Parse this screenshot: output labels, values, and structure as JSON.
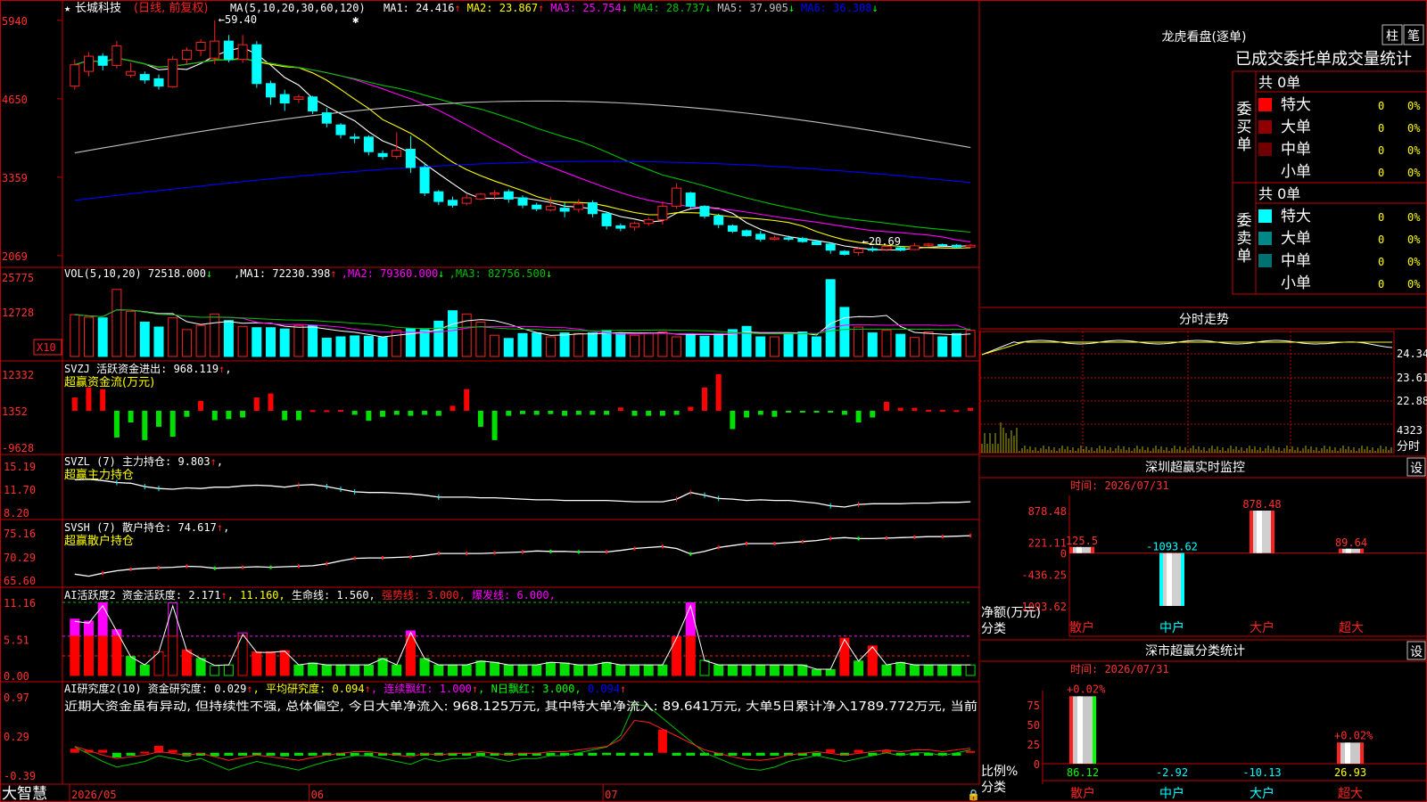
{
  "app": {
    "brand": "大智慧",
    "stock_name": "长城科技",
    "stock_mode": "(日线, 前复权)"
  },
  "colors": {
    "up": "#ff2020",
    "down": "#00ffff",
    "ma1": "#ffffff",
    "ma2": "#ffff00",
    "ma3": "#ff00ff",
    "ma4": "#00c000",
    "ma5": "#c0c0c0",
    "ma6": "#0000ff",
    "frame": "#c00000"
  },
  "dates": {
    "labels": [
      "2026/05",
      "06",
      "07"
    ],
    "label_index": [
      0,
      17,
      38
    ]
  },
  "main": {
    "title": "MA(5,10,20,30,60,120)",
    "ma_values": [
      {
        "label": "MA1: 24.416",
        "arrow": "↑",
        "color": "#ffffff"
      },
      {
        "label": "MA2: 23.867",
        "arrow": "↑",
        "color": "#ffff00"
      },
      {
        "label": "MA3: 25.754",
        "arrow": "↓",
        "color": "#ff00ff"
      },
      {
        "label": "MA4: 28.737",
        "arrow": "↓",
        "color": "#00c000"
      },
      {
        "label": "MA5: 37.905",
        "arrow": "↓",
        "color": "#c0c0c0"
      },
      {
        "label": "MA6: 36.308",
        "arrow": "↓",
        "color": "#0000ff"
      }
    ],
    "y_ticks": [
      "5940",
      "4650",
      "3359",
      "2069"
    ],
    "high_label": "59.40",
    "low_label": "←20.69",
    "candles": [
      [
        48.6,
        52.1,
        48.0,
        53.0
      ],
      [
        51.0,
        53.5,
        50.2,
        54.2
      ],
      [
        53.5,
        52.0,
        51.2,
        54.0
      ],
      [
        52.0,
        55.2,
        51.5,
        56.0
      ],
      [
        50.4,
        51.0,
        50.0,
        52.4
      ],
      [
        50.5,
        49.6,
        49.0,
        51.0
      ],
      [
        49.8,
        48.6,
        48.0,
        50.5
      ],
      [
        48.5,
        53.0,
        48.3,
        53.5
      ],
      [
        53.0,
        54.5,
        52.2,
        55.0
      ],
      [
        54.5,
        55.8,
        53.5,
        56.3
      ],
      [
        53.2,
        56.0,
        52.2,
        59.4
      ],
      [
        56.0,
        53.0,
        52.5,
        57.0
      ],
      [
        53.0,
        55.4,
        52.4,
        57.0
      ],
      [
        55.4,
        49.0,
        48.3,
        56.0
      ],
      [
        49.0,
        46.8,
        45.5,
        49.5
      ],
      [
        47.2,
        45.8,
        44.5,
        48.0
      ],
      [
        46.4,
        46.8,
        45.8,
        47.2
      ],
      [
        46.8,
        44.5,
        44.0,
        47.0
      ],
      [
        44.2,
        42.5,
        41.8,
        45.0
      ],
      [
        42.2,
        40.6,
        40.0,
        42.5
      ],
      [
        40.2,
        40.0,
        39.2,
        40.8
      ],
      [
        40.2,
        37.8,
        37.2,
        40.5
      ],
      [
        37.5,
        37.0,
        36.5,
        38.0
      ],
      [
        37.0,
        38.0,
        36.6,
        41.0
      ],
      [
        38.2,
        35.2,
        34.3,
        40.4
      ],
      [
        35.2,
        31.0,
        30.5,
        36.0
      ],
      [
        31.2,
        29.6,
        29.0,
        31.5
      ],
      [
        29.8,
        29.0,
        28.6,
        30.4
      ],
      [
        29.3,
        30.2,
        29.0,
        30.8
      ],
      [
        30.0,
        30.8,
        29.8,
        31.0
      ],
      [
        30.8,
        31.0,
        29.8,
        31.5
      ],
      [
        31.2,
        30.0,
        29.4,
        31.6
      ],
      [
        30.2,
        29.0,
        28.5,
        30.6
      ],
      [
        29.0,
        28.4,
        28.0,
        29.4
      ],
      [
        28.2,
        28.8,
        28.0,
        30.4
      ],
      [
        28.5,
        28.0,
        27.0,
        29.4
      ],
      [
        28.3,
        29.2,
        27.8,
        30.0
      ],
      [
        29.4,
        27.6,
        27.0,
        29.8
      ],
      [
        27.6,
        25.6,
        25.0,
        28.0
      ],
      [
        25.6,
        25.2,
        24.7,
        26.0
      ],
      [
        25.4,
        26.0,
        24.8,
        26.3
      ],
      [
        26.0,
        26.6,
        25.6,
        27.0
      ],
      [
        26.6,
        28.8,
        25.8,
        29.6
      ],
      [
        28.8,
        31.8,
        28.4,
        32.6
      ],
      [
        31.0,
        28.8,
        28.5,
        31.2
      ],
      [
        28.8,
        27.2,
        26.8,
        29.0
      ],
      [
        27.2,
        25.8,
        25.2,
        27.6
      ],
      [
        25.6,
        24.7,
        24.4,
        25.8
      ],
      [
        24.8,
        24.0,
        23.8,
        25.0
      ],
      [
        24.2,
        23.4,
        23.0,
        24.8
      ],
      [
        23.4,
        23.6,
        23.2,
        24.0
      ],
      [
        23.6,
        23.4,
        23.1,
        24.0
      ],
      [
        23.5,
        23.0,
        22.8,
        23.8
      ],
      [
        23.0,
        22.5,
        22.4,
        23.2
      ],
      [
        22.6,
        21.6,
        21.0,
        22.8
      ],
      [
        21.4,
        20.9,
        20.7,
        21.6
      ],
      [
        21.2,
        21.8,
        20.69,
        22.0
      ],
      [
        21.8,
        21.6,
        21.3,
        22.2
      ],
      [
        21.7,
        22.2,
        21.4,
        22.4
      ],
      [
        22.0,
        21.6,
        21.4,
        22.3
      ],
      [
        21.7,
        22.3,
        21.6,
        22.8
      ],
      [
        22.4,
        22.6,
        22.1,
        22.8
      ],
      [
        22.5,
        22.4,
        22.2,
        22.7
      ],
      [
        22.4,
        22.1,
        21.9,
        22.6
      ],
      [
        22.1,
        22.4,
        22.0,
        22.6
      ]
    ]
  },
  "vol": {
    "title": "VOL(5,10,20)",
    "current": "72518.000",
    "current_arrow": "↓",
    "mas": [
      {
        "label": "MA1: 72230.398",
        "arrow": "↑",
        "color": "#ffffff"
      },
      {
        "label": "MA2: 79360.000",
        "arrow": "↓",
        "color": "#ff00ff"
      },
      {
        "label": "MA3: 82756.500",
        "arrow": "↓",
        "color": "#00c000"
      }
    ],
    "y_ticks": [
      "25775",
      "12728"
    ],
    "unit": "X10",
    "values": [
      128,
      120,
      118,
      205,
      138,
      105,
      90,
      118,
      82,
      95,
      130,
      110,
      92,
      88,
      88,
      84,
      95,
      95,
      56,
      60,
      63,
      62,
      58,
      80,
      85,
      82,
      108,
      140,
      130,
      105,
      65,
      55,
      70,
      72,
      60,
      72,
      70,
      72,
      80,
      70,
      65,
      72,
      75,
      60,
      68,
      62,
      70,
      82,
      92,
      60,
      60,
      72,
      75,
      60,
      235,
      150,
      90,
      72,
      80,
      68,
      58,
      75,
      60,
      70,
      80
    ]
  },
  "svzj": {
    "title": "SVZJ 活跃资金进出: 968.119",
    "arrow": "↑",
    "subtitle": "超赢资金流(万元)",
    "y_ticks": [
      "12332",
      "1352",
      "-9628"
    ],
    "values": [
      4000,
      7000,
      6500,
      -8000,
      -3500,
      -8800,
      -4800,
      -7800,
      -1800,
      3000,
      -2800,
      -2500,
      -2000,
      4000,
      5200,
      -2800,
      -2800,
      200,
      150,
      250,
      -1200,
      -3000,
      -1800,
      -1200,
      -1500,
      -1200,
      -1500,
      1500,
      6500,
      -4800,
      -8800,
      -1500,
      -1000,
      -1200,
      -1000,
      -1500,
      -1200,
      -1200,
      -1200,
      1000,
      -1500,
      -1500,
      -1500,
      -1200,
      1200,
      7000,
      11000,
      -5500,
      -2000,
      -1200,
      -1800,
      -500,
      -500,
      -500,
      -500,
      -1200,
      -3500,
      -2000,
      2700,
      900,
      900,
      300,
      300,
      200,
      900
    ]
  },
  "svzl": {
    "title": "SVZL (7) 主力持仓: 9.803",
    "arrow": "↑",
    "subtitle": "超赢主力持仓",
    "y_ticks": [
      "15.19",
      "11.70",
      "8.20"
    ],
    "values": [
      13.1,
      13.2,
      13.0,
      12.7,
      12.6,
      12.1,
      11.8,
      11.7,
      11.9,
      11.8,
      12.0,
      12.0,
      12.2,
      12.3,
      12.2,
      12.0,
      12.3,
      12.4,
      12.1,
      11.7,
      11.3,
      11.2,
      11.2,
      11.1,
      11.0,
      10.8,
      10.5,
      10.5,
      10.5,
      10.4,
      10.4,
      10.3,
      10.2,
      10.1,
      10.1,
      10.0,
      10.0,
      10.0,
      10.0,
      9.9,
      9.8,
      9.8,
      9.8,
      10.2,
      11.2,
      10.8,
      10.3,
      10.2,
      10.0,
      10.1,
      10.0,
      10.0,
      9.8,
      9.6,
      9.2,
      9.0,
      9.4,
      9.5,
      9.5,
      9.5,
      9.6,
      9.6,
      9.7,
      9.7,
      9.8
    ]
  },
  "svsh": {
    "title": "SVSH (7) 散户持仓: 74.617",
    "arrow": "↑",
    "subtitle": "超赢散户持仓",
    "y_ticks": [
      "75.16",
      "70.29",
      "65.60"
    ],
    "values": [
      66.8,
      66.4,
      67.0,
      67.5,
      67.8,
      68.0,
      68.1,
      68.2,
      68.4,
      68.3,
      68.0,
      68.1,
      68.2,
      68.3,
      68.2,
      68.3,
      68.4,
      68.5,
      68.9,
      69.5,
      70.0,
      70.1,
      70.1,
      70.2,
      70.3,
      70.6,
      71.0,
      71.0,
      71.0,
      71.0,
      71.1,
      71.2,
      71.3,
      71.5,
      71.4,
      71.4,
      71.3,
      71.3,
      71.3,
      71.6,
      72.0,
      72.2,
      72.4,
      72.0,
      70.9,
      71.4,
      72.2,
      72.6,
      73.0,
      73.0,
      73.0,
      73.2,
      73.4,
      73.6,
      74.0,
      74.2,
      74.0,
      74.0,
      74.1,
      74.2,
      74.3,
      74.4,
      74.4,
      74.5,
      74.6
    ]
  },
  "ai_active": {
    "title": "AI活跃度2 资金活跃度: 2.171",
    "arrow": "↑",
    "parts": [
      {
        "text": ", 11.160,",
        "color": "#ffff00"
      },
      {
        "text": " 生命线: 1.560,",
        "color": "#ffffff"
      },
      {
        "text": " 强势线: 3.000,",
        "color": "#ff2020"
      },
      {
        "text": " 爆发线: 6.000,",
        "color": "#ff00ff"
      }
    ],
    "y_ticks": [
      "11.16",
      "5.51",
      "0.00"
    ],
    "values": [
      8.6,
      8.3,
      11.1,
      7.0,
      2.9,
      1.6,
      3.6,
      11.1,
      3.9,
      2.6,
      1.5,
      1.6,
      6.5,
      3.6,
      3.6,
      3.8,
      1.6,
      1.9,
      1.6,
      1.6,
      1.6,
      1.6,
      2.6,
      1.6,
      6.8,
      2.6,
      1.6,
      1.6,
      1.6,
      2.2,
      2.0,
      1.6,
      1.6,
      1.6,
      2.0,
      1.9,
      1.6,
      1.6,
      2.0,
      1.6,
      1.6,
      1.6,
      1.6,
      5.9,
      11.1,
      2.3,
      1.6,
      1.6,
      1.6,
      1.6,
      1.6,
      1.6,
      1.6,
      0.9,
      0.9,
      5.7,
      2.2,
      4.5,
      1.6,
      2.0,
      1.6,
      1.6,
      1.6,
      1.6,
      1.6
    ],
    "hollow": [
      false,
      false,
      false,
      false,
      false,
      false,
      true,
      true,
      false,
      false,
      true,
      true,
      true,
      false,
      false,
      false,
      false,
      false,
      false,
      false,
      false,
      false,
      false,
      false,
      false,
      false,
      false,
      false,
      false,
      false,
      false,
      false,
      false,
      false,
      false,
      false,
      false,
      false,
      false,
      false,
      false,
      false,
      false,
      false,
      false,
      true,
      false,
      false,
      false,
      false,
      false,
      false,
      false,
      false,
      false,
      false,
      false,
      false,
      false,
      false,
      false,
      false,
      false,
      false,
      true
    ]
  },
  "ai_research": {
    "title": "AI研究度2(10) 资金研究度: 0.029",
    "arrow": "↑",
    "parts": [
      {
        "text": ", 平均研究度: 0.094",
        "color": "#ffff00",
        "arrow": "↑"
      },
      {
        "text": ", 连续飘红: 1.000",
        "color": "#ff00ff",
        "arrow": "↑"
      },
      {
        "text": ", N日飘红: 3.000,",
        "color": "#00ff00"
      },
      {
        "text": " 0.094",
        "color": "#0000ff",
        "arrow": "↑"
      }
    ],
    "summary": "近期大资金虽有异动, 但持续性不强, 总体偏空, 今日大单净流入: 968.125万元, 其中特大单净流入: 89.641万元, 大单5日累计净入1789.772万元, 当前",
    "y_ticks": [
      "0.97",
      "0.29",
      "-0.39"
    ],
    "values": [
      0.07,
      0.05,
      0.05,
      -0.08,
      -0.05,
      0.02,
      0.12,
      0.05,
      -0.06,
      -0.05,
      -0.06,
      -0.05,
      -0.05,
      -0.04,
      -0.05,
      -0.06,
      -0.05,
      -0.05,
      -0.05,
      -0.05,
      -0.05,
      -0.06,
      -0.05,
      -0.05,
      -0.05,
      -0.05,
      -0.05,
      -0.05,
      -0.05,
      -0.05,
      -0.05,
      -0.05,
      -0.05,
      -0.05,
      -0.05,
      -0.05,
      -0.05,
      -0.05,
      -0.04,
      -0.05,
      -0.05,
      -0.05,
      0.4,
      -0.05,
      -0.05,
      -0.05,
      -0.05,
      -0.05,
      -0.05,
      -0.05,
      -0.05,
      -0.05,
      -0.05,
      -0.05,
      0.06,
      -0.05,
      0.05,
      -0.05,
      0.04,
      -0.05,
      -0.05,
      -0.05,
      -0.05,
      -0.05,
      0.03
    ],
    "line": [
      0.1,
      -0.02,
      -0.15,
      -0.25,
      -0.2,
      -0.15,
      -0.05,
      -0.1,
      -0.15,
      -0.1,
      -0.2,
      -0.3,
      -0.22,
      -0.15,
      -0.2,
      -0.25,
      -0.3,
      -0.22,
      -0.15,
      -0.1,
      -0.05,
      -0.05,
      -0.1,
      -0.15,
      -0.2,
      -0.1,
      -0.15,
      -0.1,
      -0.1,
      -0.05,
      -0.1,
      -0.15,
      -0.1,
      -0.1,
      -0.05,
      -0.05,
      0.0,
      0.05,
      0.1,
      0.3,
      0.85,
      0.8,
      0.6,
      0.4,
      0.2,
      0.0,
      -0.1,
      -0.2,
      -0.28,
      -0.3,
      -0.25,
      -0.15,
      -0.1,
      -0.05,
      -0.1,
      -0.15,
      -0.1,
      -0.05,
      0.0,
      -0.05,
      0.0,
      0.0,
      -0.05,
      0.0,
      0.05
    ]
  },
  "right": {
    "board_title": "龙虎看盘(逐单)",
    "btn_bar": "柱",
    "btn_stroke": "笔",
    "stats_title": "已成交委托单成交量统计",
    "buy_label": "委买单",
    "sell_label": "委卖单",
    "buy_total": "共 0单",
    "sell_total": "共 0单",
    "buy_rows": [
      {
        "name": "特大",
        "count": "0",
        "pct": "0%",
        "color": "#ff0000"
      },
      {
        "name": "大单",
        "count": "0",
        "pct": "0%",
        "color": "#900000"
      },
      {
        "name": "中单",
        "count": "0",
        "pct": "0%",
        "color": "#700000"
      },
      {
        "name": "小单",
        "count": "0",
        "pct": "0%",
        "color": ""
      }
    ],
    "sell_rows": [
      {
        "name": "特大",
        "count": "0",
        "pct": "0%",
        "color": "#00ffff"
      },
      {
        "name": "大单",
        "count": "0",
        "pct": "0%",
        "color": "#008888"
      },
      {
        "name": "中单",
        "count": "0",
        "pct": "0%",
        "color": "#007070"
      },
      {
        "name": "小单",
        "count": "0",
        "pct": "0%",
        "color": ""
      }
    ],
    "intraday_title": "分时走势",
    "intraday_ticks": [
      "24.34",
      "23.61",
      "22.88"
    ],
    "intraday_vol": "4323",
    "intraday_bottom": "分时",
    "monitor_title": "深圳超赢实时监控",
    "monitor_btn": "设",
    "monitor_time": "时间: 2026/07/31",
    "monitor_ticks": [
      "878.48",
      "221.11",
      "0",
      "-436.25",
      "-1093.62"
    ],
    "monitor_ylabel": "净额(万元)",
    "monitor_xlabel": "分类",
    "monitor_data": [
      {
        "cat": "散户",
        "value": 125.5,
        "label": "125.5",
        "cat_color": "#ff2020"
      },
      {
        "cat": "中户",
        "value": -1093.62,
        "label": "-1093.62",
        "cat_color": "#00ffff"
      },
      {
        "cat": "大户",
        "value": 878.48,
        "label": "878.48",
        "cat_color": "#ff2020"
      },
      {
        "cat": "超大",
        "value": 89.64,
        "label": "89.64",
        "cat_color": "#ff2020"
      }
    ],
    "class_title": "深市超赢分类统计",
    "class_btn": "设",
    "class_time": "时间: 2026/07/31",
    "class_ticks": [
      "75",
      "50",
      "25",
      "0"
    ],
    "class_ylabel": "比例%",
    "class_xlabel": "分类",
    "class_data": [
      {
        "cat": "散户",
        "value": 86.12,
        "label": "86.12",
        "top": "+0.02%",
        "label_color": "#00ff00",
        "cat_color": "#ff2020"
      },
      {
        "cat": "中户",
        "value": -2.92,
        "label": "-2.92",
        "top": "",
        "label_color": "#00ffff",
        "cat_color": "#00ffff"
      },
      {
        "cat": "大户",
        "value": -10.13,
        "label": "-10.13",
        "top": "",
        "label_color": "#00ffff",
        "cat_color": "#00ffff"
      },
      {
        "cat": "超大",
        "value": 26.93,
        "label": "26.93",
        "top": "+0.02%",
        "label_color": "#ffff00",
        "cat_color": "#ff2020"
      }
    ]
  },
  "chart_data": [
    {
      "type": "candlestick",
      "title": "长城科技 (日线, 前复权)",
      "series_ref": "main.candles",
      "fields": [
        "open",
        "close",
        "low",
        "high"
      ],
      "ylim": [
        19.5,
        61.0
      ],
      "max": 59.4,
      "min": 20.69
    },
    {
      "type": "bar",
      "title": "VOL(5,10,20)",
      "series_ref": "vol.values",
      "unit": "X10"
    },
    {
      "type": "bar",
      "title": "SVZJ 活跃资金进出",
      "series_ref": "svzj.values",
      "ylim": [
        -9628,
        12332
      ]
    },
    {
      "type": "line",
      "title": "SVZL 主力持仓",
      "series_ref": "svzl.values",
      "ylim": [
        8.2,
        15.19
      ]
    },
    {
      "type": "line",
      "title": "SVSH 散户持仓",
      "series_ref": "svsh.values",
      "ylim": [
        65.6,
        75.16
      ]
    },
    {
      "type": "bar",
      "title": "AI活跃度2",
      "series_ref": "ai_active.values",
      "ylim": [
        0,
        11.16
      ]
    },
    {
      "type": "bar",
      "title": "AI研究度2(10)",
      "series_ref": "ai_research.values",
      "ylim": [
        -0.39,
        0.97
      ]
    },
    {
      "type": "bar",
      "title": "深圳超赢实时监控",
      "categories": [
        "散户",
        "中户",
        "大户",
        "超大"
      ],
      "values": [
        125.5,
        -1093.62,
        878.48,
        89.64
      ],
      "ylim": [
        -1093.62,
        878.48
      ]
    },
    {
      "type": "bar",
      "title": "深市超赢分类统计",
      "categories": [
        "散户",
        "中户",
        "大户",
        "超大"
      ],
      "values": [
        86.12,
        -2.92,
        -10.13,
        26.93
      ],
      "ylim": [
        0,
        90
      ]
    }
  ]
}
